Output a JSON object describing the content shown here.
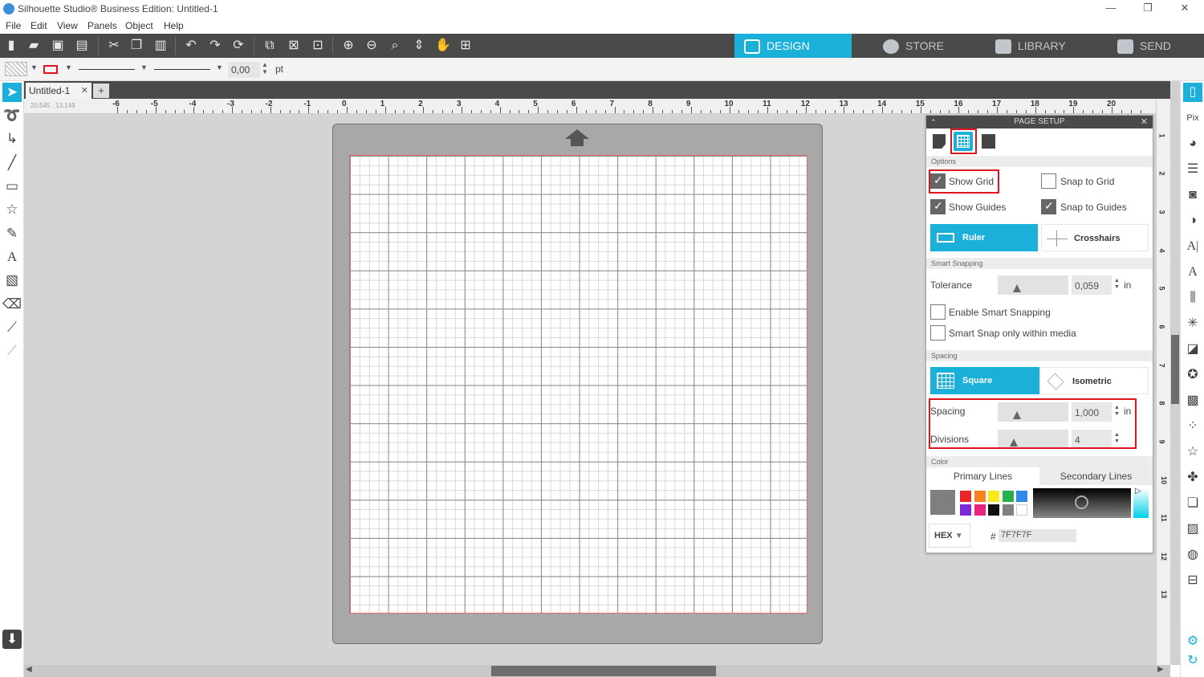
{
  "window": {
    "title": "Silhouette Studio® Business Edition: Untitled-1",
    "controls": [
      "—",
      "❐",
      "✕"
    ]
  },
  "menu": [
    "File",
    "Edit",
    "View",
    "Panels",
    "Object",
    "Help"
  ],
  "nav_tabs": [
    {
      "label": "DESIGN",
      "active": true
    },
    {
      "label": "STORE",
      "active": false
    },
    {
      "label": "LIBRARY",
      "active": false
    },
    {
      "label": "SEND",
      "active": false
    }
  ],
  "linebar": {
    "line_width": "0,00",
    "unit": "pt"
  },
  "document": {
    "tab_label": "Untitled-1",
    "coords": "20,545 , 13,149"
  },
  "ruler": {
    "h_numbers": [
      "-6",
      "-5",
      "-4",
      "-3",
      "-2",
      "-1",
      "0",
      "1",
      "2",
      "3",
      "4",
      "5",
      "6",
      "7",
      "8",
      "9",
      "10",
      "11",
      "12",
      "13",
      "14",
      "15",
      "16",
      "17",
      "18",
      "19",
      "20"
    ],
    "v_numbers": [
      "1",
      "2",
      "3",
      "4",
      "5",
      "6",
      "7",
      "8",
      "9",
      "10",
      "11",
      "12",
      "13"
    ]
  },
  "page_setup": {
    "title": "PAGE SETUP",
    "sections": {
      "options": "Options",
      "smart_snapping": "Smart Snapping",
      "spacing": "Spacing",
      "color": "Color"
    },
    "options": {
      "show_grid": {
        "label": "Show Grid",
        "checked": true
      },
      "snap_to_grid": {
        "label": "Snap to Grid",
        "checked": false
      },
      "show_guides": {
        "label": "Show Guides",
        "checked": true
      },
      "snap_to_guides": {
        "label": "Snap to Guides",
        "checked": true
      },
      "ruler_btn": "Ruler",
      "crosshairs_btn": "Crosshairs"
    },
    "smart_snapping": {
      "tolerance_label": "Tolerance",
      "tolerance_value": "0,059",
      "tolerance_unit": "in",
      "enable_label": "Enable Smart Snapping",
      "media_label": "Smart Snap only within media"
    },
    "spacing": {
      "square_btn": "Square",
      "isometric_btn": "Isometric",
      "spacing_label": "Spacing",
      "spacing_value": "1,000",
      "spacing_unit": "in",
      "divisions_label": "Divisions",
      "divisions_value": "4"
    },
    "color": {
      "primary_tab": "Primary Lines",
      "secondary_tab": "Secondary Lines",
      "mode": "HEX",
      "hash": "#",
      "hex_value": "7F7F7F",
      "current": "#7f7f7f",
      "swatches": [
        "#e8262a",
        "#f58220",
        "#f7e91a",
        "#24b24b",
        "#2e88e8",
        "#7a2ad8",
        "#e8237f",
        "#111111",
        "#808080",
        "#ffffff"
      ]
    }
  },
  "colors": {
    "accent": "#1bb0d9",
    "toolbar": "#4a4a4a",
    "highlight_box": "#e0141e"
  }
}
